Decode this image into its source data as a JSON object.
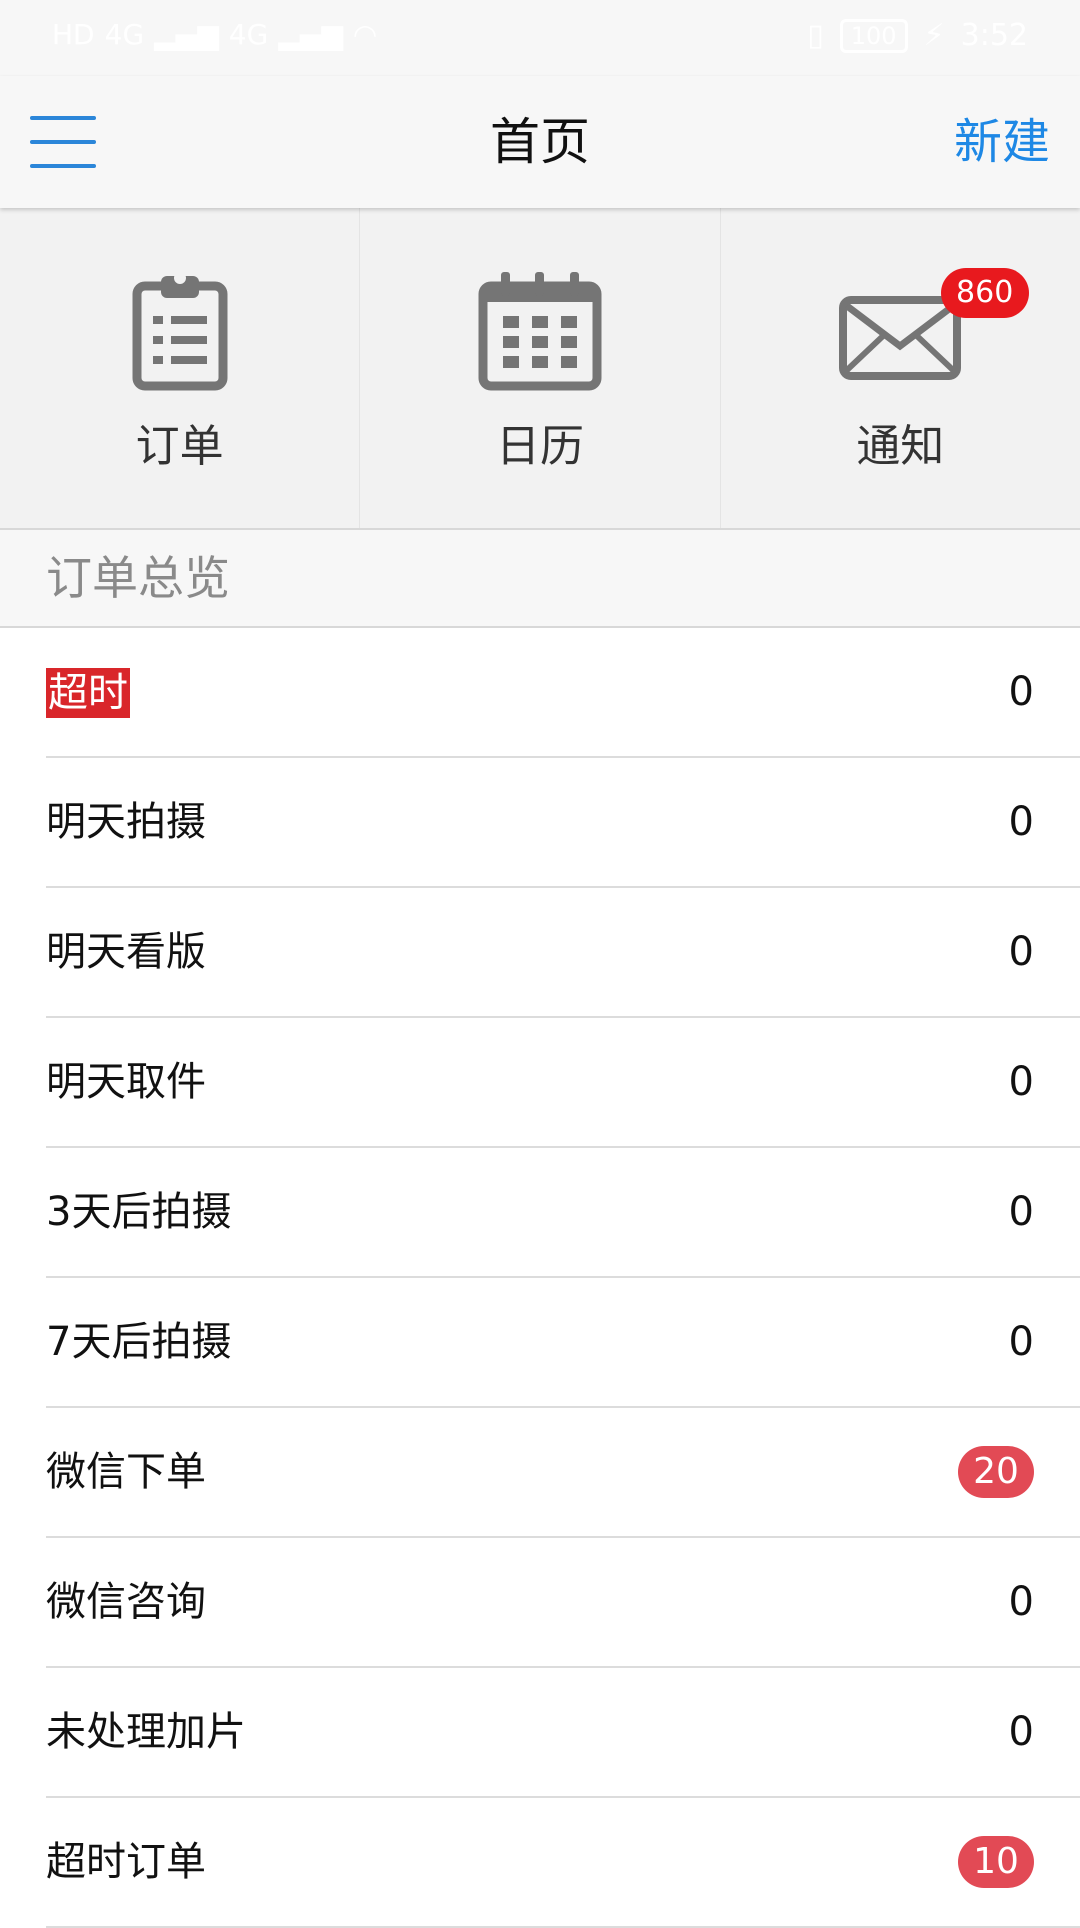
{
  "status_bar": {
    "time": "3:52",
    "battery": "100",
    "network": [
      "4G",
      "4G"
    ]
  },
  "header": {
    "title": "首页",
    "new_label": "新建"
  },
  "quick_tiles": [
    {
      "label": "订单",
      "icon": "clipboard-icon"
    },
    {
      "label": "日历",
      "icon": "calendar-icon"
    },
    {
      "label": "通知",
      "icon": "envelope-icon",
      "badge": "860"
    }
  ],
  "section": {
    "title": "订单总览"
  },
  "orders": [
    {
      "label": "超时",
      "count": "0",
      "alert": true
    },
    {
      "label": "明天拍摄",
      "count": "0"
    },
    {
      "label": "明天看版",
      "count": "0"
    },
    {
      "label": "明天取件",
      "count": "0"
    },
    {
      "label": "3天后拍摄",
      "count": "0"
    },
    {
      "label": "7天后拍摄",
      "count": "0"
    },
    {
      "label": "微信下单",
      "count": "20",
      "highlight": true
    },
    {
      "label": "微信咨询",
      "count": "0"
    },
    {
      "label": "未处理加片",
      "count": "0"
    },
    {
      "label": "超时订单",
      "count": "10",
      "highlight": true
    }
  ],
  "colors": {
    "accent": "#1e88e5",
    "badge": "#e8191e",
    "pill": "#e24a55",
    "alert": "#d9262a",
    "icon_gray": "#757575"
  }
}
